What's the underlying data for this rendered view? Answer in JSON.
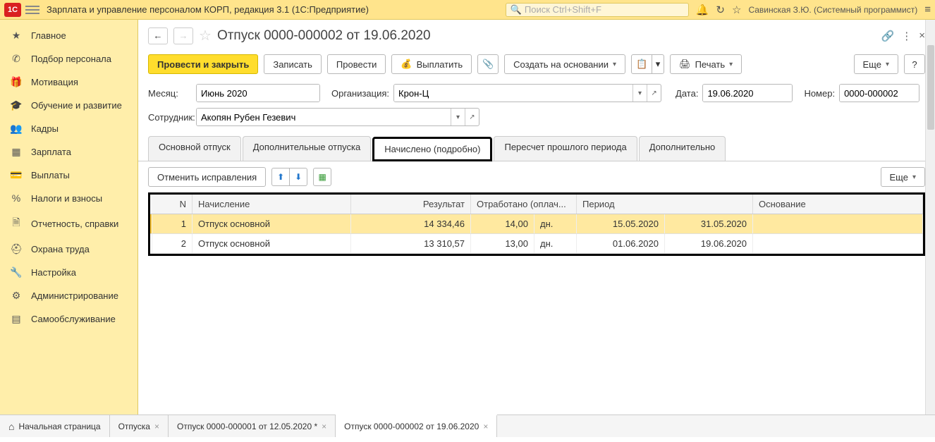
{
  "top": {
    "logo": "1C",
    "app_title": "Зарплата и управление персоналом КОРП, редакция 3.1  (1С:Предприятие)",
    "search_placeholder": "Поиск Ctrl+Shift+F",
    "user": "Савинская З.Ю. (Системный программист)"
  },
  "sidebar": [
    {
      "icon": "★",
      "label": "Главное"
    },
    {
      "icon": "✆",
      "label": "Подбор персонала"
    },
    {
      "icon": "🎁",
      "label": "Мотивация"
    },
    {
      "icon": "🎓",
      "label": "Обучение и развитие"
    },
    {
      "icon": "👥",
      "label": "Кадры"
    },
    {
      "icon": "▦",
      "label": "Зарплата"
    },
    {
      "icon": "💳",
      "label": "Выплаты"
    },
    {
      "icon": "%",
      "label": "Налоги и взносы"
    },
    {
      "icon": "🗎",
      "label": "Отчетность, справки"
    },
    {
      "icon": "⛑",
      "label": "Охрана труда"
    },
    {
      "icon": "🔧",
      "label": "Настройка"
    },
    {
      "icon": "⚙",
      "label": "Администрирование"
    },
    {
      "icon": "▤",
      "label": "Самообслуживание"
    }
  ],
  "doc": {
    "title": "Отпуск 0000-000002 от 19.06.2020",
    "toolbar": {
      "post_close": "Провести и закрыть",
      "save": "Записать",
      "post": "Провести",
      "pay": "Выплатить",
      "create_based": "Создать на основании",
      "print": "Печать",
      "more": "Еще",
      "help": "?"
    },
    "fields": {
      "month_label": "Месяц:",
      "month_value": "Июнь 2020",
      "org_label": "Организация:",
      "org_value": "Крон-Ц",
      "date_label": "Дата:",
      "date_value": "19.06.2020",
      "number_label": "Номер:",
      "number_value": "0000-000002",
      "employee_label": "Сотрудник:",
      "employee_value": "Акопян Рубен Гезевич"
    },
    "tabs": [
      "Основной отпуск",
      "Дополнительные отпуска",
      "Начислено (подробно)",
      "Пересчет прошлого периода",
      "Дополнительно"
    ],
    "tab_toolbar": {
      "cancel_fix": "Отменить исправления",
      "more": "Еще"
    },
    "grid": {
      "headers": {
        "n": "N",
        "name": "Начисление",
        "result": "Результат",
        "worked": "Отработано (оплач...",
        "period": "Период",
        "basis": "Основание"
      },
      "rows": [
        {
          "n": "1",
          "name": "Отпуск основной",
          "result": "14 334,46",
          "worked": "14,00",
          "unit": "дн.",
          "p1": "15.05.2020",
          "p2": "31.05.2020",
          "basis": ""
        },
        {
          "n": "2",
          "name": "Отпуск основной",
          "result": "13 310,57",
          "worked": "13,00",
          "unit": "дн.",
          "p1": "01.06.2020",
          "p2": "19.06.2020",
          "basis": ""
        }
      ]
    }
  },
  "bottom_tabs": [
    {
      "label": "Начальная страница",
      "home": true,
      "closable": false
    },
    {
      "label": "Отпуска",
      "closable": true
    },
    {
      "label": "Отпуск 0000-000001 от 12.05.2020 *",
      "closable": true
    },
    {
      "label": "Отпуск 0000-000002 от 19.06.2020",
      "closable": true,
      "active": true
    }
  ]
}
